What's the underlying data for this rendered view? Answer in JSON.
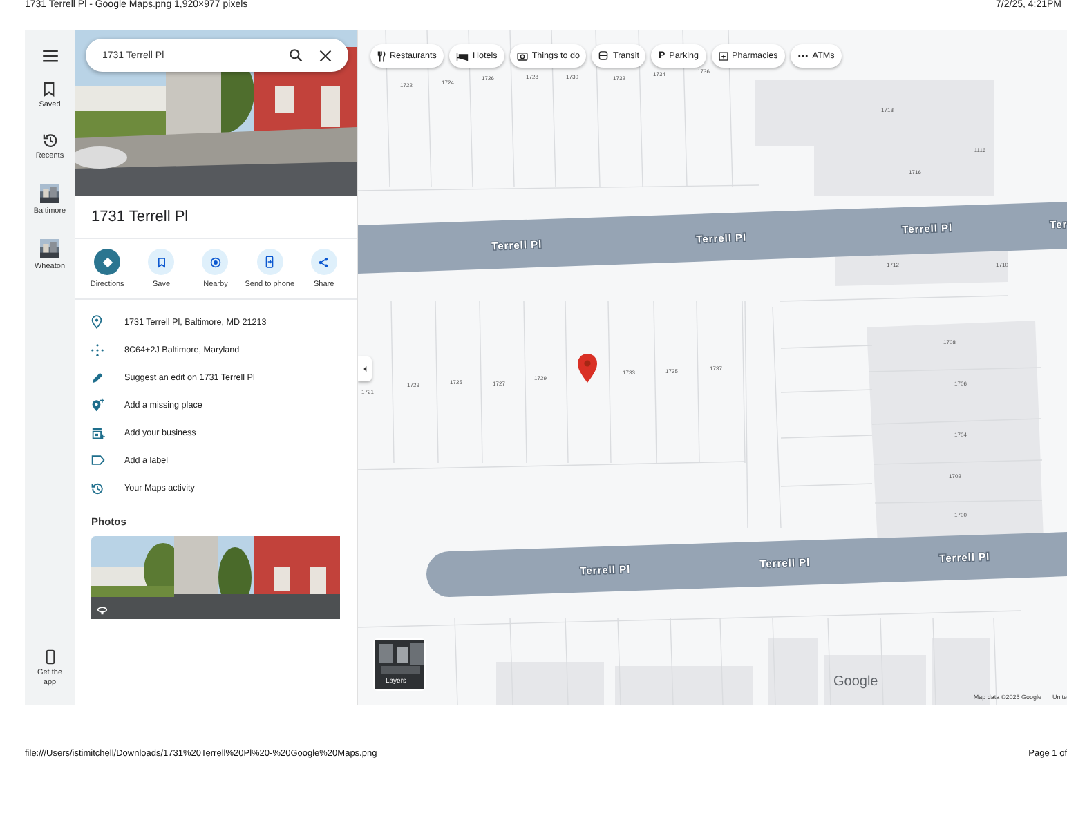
{
  "print_header": {
    "title": "1731 Terrell Pl - Google Maps.png 1,920×977 pixels",
    "date": "7/2/25, 4:21PM"
  },
  "rail": {
    "items": [
      {
        "label": "Saved",
        "kind": "saved"
      },
      {
        "label": "Recents",
        "kind": "recents"
      },
      {
        "label": "Baltimore",
        "kind": "place"
      },
      {
        "label": "Wheaton",
        "kind": "place"
      }
    ],
    "get_app": "Get the app"
  },
  "search": {
    "value": "1731 Terrell Pl"
  },
  "place": {
    "title": "1731 Terrell Pl",
    "actions": [
      {
        "label": "Directions",
        "kind": "directions",
        "selected": true
      },
      {
        "label": "Save",
        "kind": "save",
        "selected": false
      },
      {
        "label": "Nearby",
        "kind": "nearby",
        "selected": false
      },
      {
        "label": "Send to phone",
        "kind": "phone",
        "selected": false
      },
      {
        "label": "Share",
        "kind": "share",
        "selected": false
      }
    ],
    "details": [
      {
        "kind": "pin",
        "text": "1731 Terrell Pl, Baltimore, MD 21213"
      },
      {
        "kind": "plus-code",
        "text": "8C64+2J Baltimore, Maryland"
      },
      {
        "kind": "edit",
        "text": "Suggest an edit on 1731 Terrell Pl"
      },
      {
        "kind": "add-place",
        "text": "Add a missing place"
      },
      {
        "kind": "business",
        "text": "Add your business"
      },
      {
        "kind": "label",
        "text": "Add a label"
      },
      {
        "kind": "history",
        "text": "Your Maps activity"
      }
    ],
    "photos_heading": "Photos"
  },
  "chips": [
    {
      "label": "Restaurants",
      "kind": "restaurants"
    },
    {
      "label": "Hotels",
      "kind": "hotels"
    },
    {
      "label": "Things to do",
      "kind": "camera"
    },
    {
      "label": "Transit",
      "kind": "transit"
    },
    {
      "label": "Parking",
      "kind": "parking",
      "glyph": "P"
    },
    {
      "label": "Pharmacies",
      "kind": "pharmacy"
    },
    {
      "label": "ATMs",
      "kind": "more"
    }
  ],
  "map": {
    "north_lots": [
      "1722",
      "1724",
      "1726",
      "1728",
      "1730",
      "1732",
      "1734",
      "1736"
    ],
    "annex_lots": [
      "1718",
      "1116",
      "1716"
    ],
    "east_lots": [
      "1712",
      "1710"
    ],
    "south_lots": [
      "1721",
      "1723",
      "1725",
      "1727",
      "1729",
      "1733",
      "1735",
      "1737"
    ],
    "corner_lots": [
      "1708",
      "1706",
      "1704",
      "1702",
      "1700"
    ],
    "upper_street_labels": [
      "Terrell Pl",
      "Terrell Pl",
      "Terrell Pl",
      "Ter"
    ],
    "lower_street_labels": [
      "Terrell Pl",
      "Terrell Pl",
      "Terrell Pl"
    ],
    "layers_label": "Layers",
    "logo": "Google",
    "attribution": "Map data ©2025 Google",
    "attribution_cut": "Unite"
  },
  "print_footer": {
    "path": "file:///Users/istimitchell/Downloads/1731%20Terrell%20Pl%20-%20Google%20Maps.png",
    "page": "Page 1 of"
  }
}
